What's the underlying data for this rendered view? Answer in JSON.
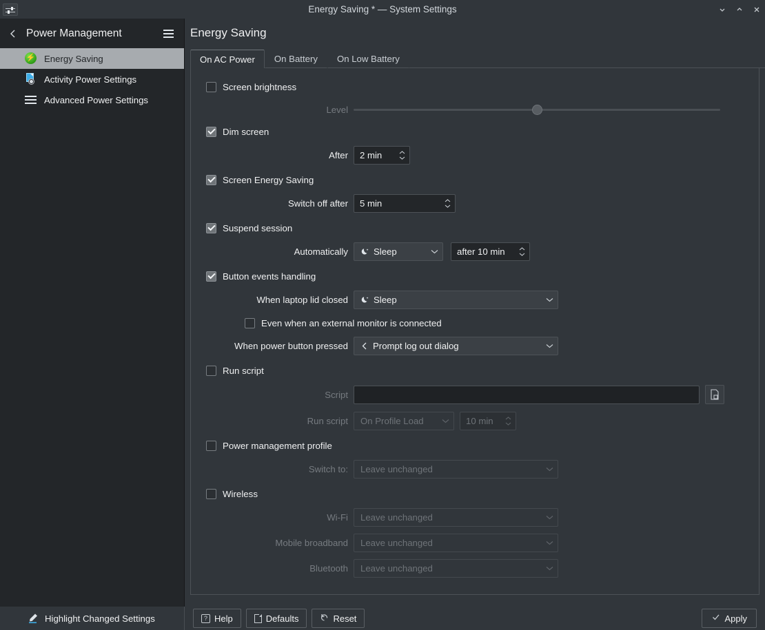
{
  "window": {
    "title": "Energy Saving * — System Settings",
    "app_icon": "sliders-icon",
    "controls": [
      {
        "name": "minimize",
        "glyph": "chevron-down"
      },
      {
        "name": "maximize",
        "glyph": "chevron-up"
      },
      {
        "name": "close",
        "glyph": "close-x"
      }
    ]
  },
  "sidebar": {
    "back_label": "‹",
    "title": "Power Management",
    "menu_label": "hamburger-menu",
    "items": [
      {
        "label": "Energy Saving",
        "icon": "energy-bolt-icon",
        "active": true
      },
      {
        "label": "Activity Power Settings",
        "icon": "activity-document-icon",
        "active": false
      },
      {
        "label": "Advanced Power Settings",
        "icon": "lines-icon",
        "active": false
      }
    ]
  },
  "main": {
    "page_title": "Energy Saving",
    "tabs": [
      {
        "label": "On AC Power",
        "active": true
      },
      {
        "label": "On Battery",
        "active": false
      },
      {
        "label": "On Low Battery",
        "active": false
      }
    ],
    "sections": {
      "screen_brightness": {
        "checkbox_label": "Screen brightness",
        "checked": false,
        "level_label": "Level",
        "level_value": 50
      },
      "dim_screen": {
        "checkbox_label": "Dim screen",
        "checked": true,
        "after_label": "After",
        "after_value": "2 min"
      },
      "screen_energy_saving": {
        "checkbox_label": "Screen Energy Saving",
        "checked": true,
        "switch_off_label": "Switch off after",
        "switch_off_value": "5 min"
      },
      "suspend_session": {
        "checkbox_label": "Suspend session",
        "checked": true,
        "automatically_label": "Automatically",
        "automatically_value": "Sleep",
        "automatically_icon": "moon-icon",
        "delay_value": "after 10 min"
      },
      "button_events": {
        "checkbox_label": "Button events handling",
        "checked": true,
        "lid_label": "When laptop lid closed",
        "lid_value": "Sleep",
        "lid_icon": "moon-icon",
        "external_monitor_label": "Even when an external monitor is connected",
        "external_monitor_checked": false,
        "power_button_label": "When power button pressed",
        "power_button_value": "Prompt log out dialog",
        "power_button_icon": "logout-icon"
      },
      "run_script": {
        "checkbox_label": "Run script",
        "checked": false,
        "script_label": "Script",
        "script_value": "",
        "browse_icon": "file-browse-icon",
        "run_script_label": "Run script",
        "trigger_value": "On Profile Load",
        "idle_value": "10 min"
      },
      "power_profile": {
        "checkbox_label": "Power management profile",
        "checked": false,
        "switch_to_label": "Switch to:",
        "switch_to_value": "Leave unchanged"
      },
      "wireless": {
        "checkbox_label": "Wireless",
        "checked": false,
        "rows": [
          {
            "label": "Wi-Fi",
            "value": "Leave unchanged"
          },
          {
            "label": "Mobile broadband",
            "value": "Leave unchanged"
          },
          {
            "label": "Bluetooth",
            "value": "Leave unchanged"
          }
        ]
      }
    }
  },
  "bottombar": {
    "highlight_label": "Highlight Changed Settings",
    "highlight_icon": "highlighter-pen-icon",
    "buttons": [
      {
        "label": "Help",
        "icon": "help-icon"
      },
      {
        "label": "Defaults",
        "icon": "defaults-page-icon"
      },
      {
        "label": "Reset",
        "icon": "reset-arrow-icon"
      }
    ],
    "apply_label": "Apply",
    "apply_icon": "check-icon"
  },
  "colors": {
    "window_bg": "#31363b",
    "sidebar_bg": "#232629",
    "sidebar_active_bg": "#a7abaf",
    "text": "#eff0f1",
    "text_disabled": "#6e7378",
    "border": "#4d5257",
    "accent_green": "#2f9e18"
  }
}
